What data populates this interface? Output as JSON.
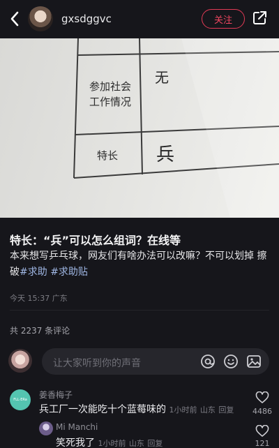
{
  "header": {
    "username": "gxsdggvc",
    "follow_label": "关注",
    "icons": {
      "back": "back-arrow-icon",
      "share": "share-icon"
    }
  },
  "photo": {
    "row1_label_line1": "参加社会",
    "row1_label_line2": "工作情况",
    "row1_value": "无",
    "row2_label": "特长",
    "row2_value": "兵"
  },
  "post": {
    "title": "特长：“兵”可以怎么组词？在线等",
    "body_text": "本来想写乒乓球，网友们有啥办法可以改嘛？不可以划掉 擦破",
    "tags": [
      "#求助",
      "#求助贴"
    ],
    "timestamp": "今天 15:37",
    "location": "广东"
  },
  "comments_section": {
    "count_label": "共 2237 条评论",
    "input_placeholder": "让大家听到你的声音",
    "input_icons": [
      "at-icon",
      "emoji-icon",
      "image-icon"
    ],
    "items": [
      {
        "author": "姜香梅子",
        "text": "兵工厂一次能吃十个蓝莓味的",
        "time": "1小时前",
        "location": "山东",
        "reply_label": "回复",
        "likes": "4486",
        "avatar_text": "FLL·ERa"
      },
      {
        "author": "Mi Manchi",
        "text": "笑死我了",
        "time": "1小时前",
        "location": "山东",
        "reply_label": "回复",
        "likes": "121"
      }
    ]
  },
  "colors": {
    "background": "#16161b",
    "accent": "#e23a55",
    "tag": "#9fb6e3"
  }
}
